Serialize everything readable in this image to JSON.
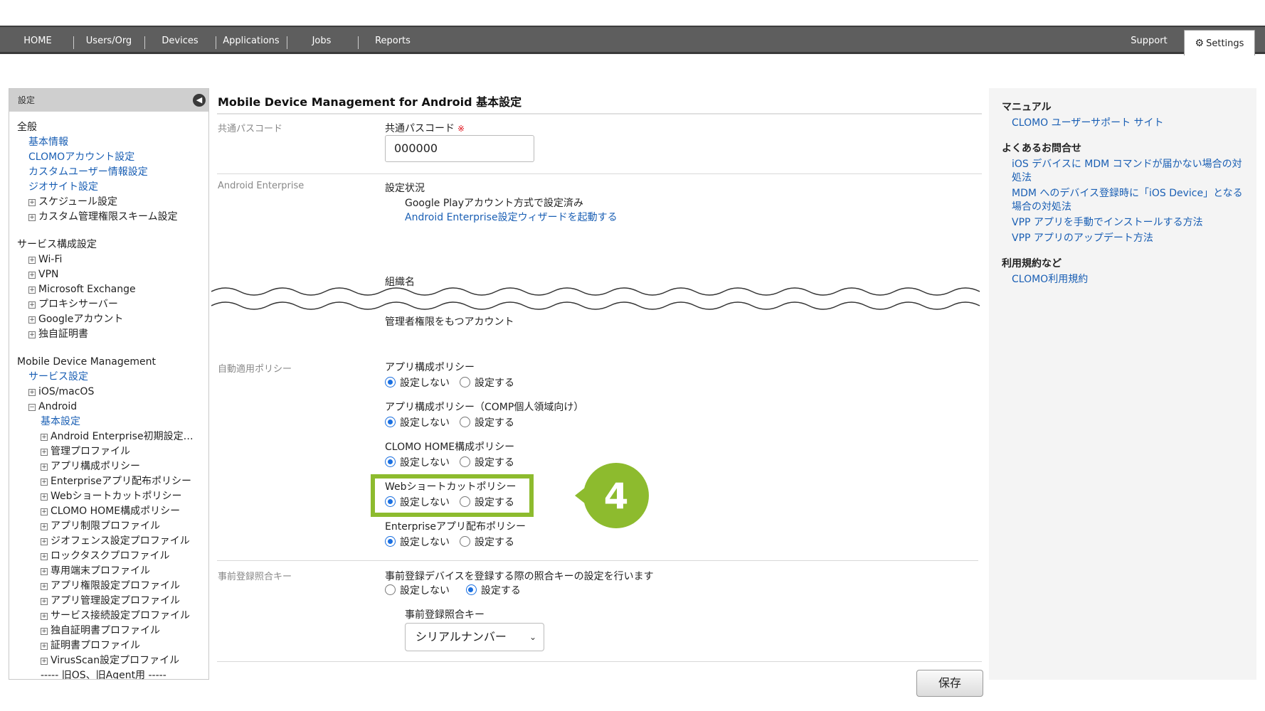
{
  "nav": {
    "items": [
      "HOME",
      "Users/Org",
      "Devices",
      "Applications",
      "Jobs",
      "Reports"
    ],
    "support": "Support",
    "settings": "Settings"
  },
  "sidebar": {
    "header": "設定",
    "general": {
      "title": "全般",
      "links": [
        "基本情報",
        "CLOMOアカウント設定",
        "カスタムユーザー情報設定",
        "ジオサイト設定"
      ],
      "items": [
        "スケジュール設定",
        "カスタム管理権限スキーム設定"
      ]
    },
    "service": {
      "title": "サービス構成設定",
      "items": [
        "Wi-Fi",
        "VPN",
        "Microsoft Exchange",
        "プロキシサーバー",
        "Googleアカウント",
        "独自証明書"
      ]
    },
    "mdm": {
      "title": "Mobile Device Management",
      "link": "サービス設定",
      "ios": "iOS/macOS",
      "android": "Android",
      "android_link": "基本設定",
      "android_items": [
        "Android Enterprise初期設定…",
        "管理プロファイル",
        "アプリ構成ポリシー",
        "Enterpriseアプリ配布ポリシー",
        "Webショートカットポリシー",
        "CLOMO HOME構成ポリシー",
        "アプリ制限プロファイル",
        "ジオフェンス設定プロファイル",
        "ロックタスクプロファイル",
        "専用端末プロファイル",
        "アプリ権限設定プロファイル",
        "アプリ管理設定プロファイル",
        "サービス接続設定プロファイル",
        "独自証明書プロファイル",
        "証明書プロファイル",
        "VirusScan設定プロファイル"
      ],
      "legacy": "----- 旧OS、旧Agent用 -----"
    }
  },
  "main": {
    "title": "Mobile Device Management for Android 基本設定",
    "passcode": {
      "section": "共通パスコード",
      "label": "共通パスコード",
      "required_mark": "※",
      "value": "000000"
    },
    "enterprise": {
      "section": "Android Enterprise",
      "status_label": "設定状況",
      "status_value": "Google Playアカウント方式で設定済み",
      "wizard_link": "Android Enterprise設定ウィザードを起動する",
      "org_label": "組織名",
      "admin_label": "管理者権限をもつアカウント"
    },
    "auto_policy": {
      "section": "自動適用ポリシー",
      "off_label": "設定しない",
      "on_label": "設定する",
      "policies": [
        {
          "name": "アプリ構成ポリシー",
          "selected": "off"
        },
        {
          "name": "アプリ構成ポリシー（COMP個人領域向け）",
          "selected": "off"
        },
        {
          "name": "CLOMO HOME構成ポリシー",
          "selected": "off"
        },
        {
          "name": "Webショートカットポリシー",
          "selected": "off"
        },
        {
          "name": "Enterpriseアプリ配布ポリシー",
          "selected": "off"
        }
      ]
    },
    "prereg": {
      "section": "事前登録照合キー",
      "description": "事前登録デバイスを登録する際の照合キーの設定を行います",
      "off_label": "設定しない",
      "on_label": "設定する",
      "selected": "on",
      "key_label": "事前登録照合キー",
      "key_value": "シリアルナンバー"
    },
    "callout_number": "4",
    "save_label": "保存"
  },
  "right": {
    "manual_title": "マニュアル",
    "manual_link": "CLOMO ユーザーサポート サイト",
    "faq_title": "よくあるお問合せ",
    "faq_links": [
      "iOS デバイスに MDM コマンドが届かない場合の対処法",
      "MDM へのデバイス登録時に「iOS Device」となる場合の対処法",
      "VPP アプリを手動でインストールする方法",
      "VPP アプリのアップデート方法"
    ],
    "terms_title": "利用規約など",
    "terms_link": "CLOMO利用規約"
  }
}
